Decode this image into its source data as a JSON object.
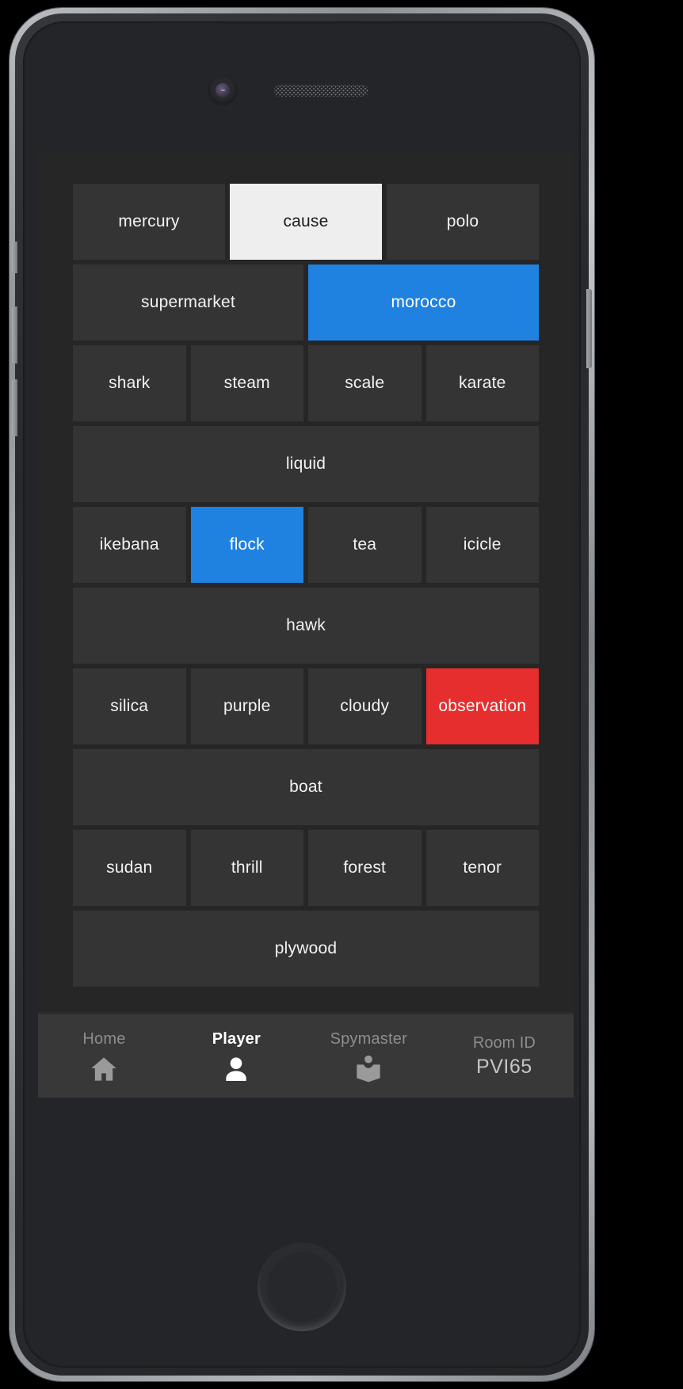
{
  "device": {
    "camera_icon": "front-camera",
    "speaker_icon": "earpiece-speaker",
    "home_button_icon": "home-button"
  },
  "game": {
    "board": {
      "rows": [
        [
          {
            "word": "mercury",
            "state": "unrevealed",
            "color": "#343434"
          },
          {
            "word": "cause",
            "state": "neutral",
            "color": "#eeeeee"
          },
          {
            "word": "polo",
            "state": "unrevealed",
            "color": "#343434"
          }
        ],
        [
          {
            "word": "supermarket",
            "state": "unrevealed",
            "color": "#343434"
          },
          {
            "word": "morocco",
            "state": "blue",
            "color": "#1f82e0"
          }
        ],
        [
          {
            "word": "shark",
            "state": "unrevealed",
            "color": "#343434"
          },
          {
            "word": "steam",
            "state": "unrevealed",
            "color": "#343434"
          },
          {
            "word": "scale",
            "state": "unrevealed",
            "color": "#343434"
          },
          {
            "word": "karate",
            "state": "unrevealed",
            "color": "#343434"
          }
        ],
        [
          {
            "word": "liquid",
            "state": "unrevealed",
            "color": "#343434"
          }
        ],
        [
          {
            "word": "ikebana",
            "state": "unrevealed",
            "color": "#343434"
          },
          {
            "word": "flock",
            "state": "blue",
            "color": "#1f82e0"
          },
          {
            "word": "tea",
            "state": "unrevealed",
            "color": "#343434"
          },
          {
            "word": "icicle",
            "state": "unrevealed",
            "color": "#343434"
          }
        ],
        [
          {
            "word": "hawk",
            "state": "unrevealed",
            "color": "#343434"
          }
        ],
        [
          {
            "word": "silica",
            "state": "unrevealed",
            "color": "#343434"
          },
          {
            "word": "purple",
            "state": "unrevealed",
            "color": "#343434"
          },
          {
            "word": "cloudy",
            "state": "unrevealed",
            "color": "#343434"
          },
          {
            "word": "observation",
            "state": "red",
            "color": "#e62e2e"
          }
        ],
        [
          {
            "word": "boat",
            "state": "unrevealed",
            "color": "#343434"
          }
        ],
        [
          {
            "word": "sudan",
            "state": "unrevealed",
            "color": "#343434"
          },
          {
            "word": "thrill",
            "state": "unrevealed",
            "color": "#343434"
          },
          {
            "word": "forest",
            "state": "unrevealed",
            "color": "#343434"
          },
          {
            "word": "tenor",
            "state": "unrevealed",
            "color": "#343434"
          }
        ],
        [
          {
            "word": "plywood",
            "state": "unrevealed",
            "color": "#343434"
          }
        ]
      ]
    },
    "navbar": {
      "items": [
        {
          "label": "Home",
          "icon": "home-icon",
          "active": false
        },
        {
          "label": "Player",
          "icon": "person-icon",
          "active": true
        },
        {
          "label": "Spymaster",
          "icon": "spymaster-icon",
          "active": false
        }
      ],
      "room": {
        "label": "Room ID",
        "code": "PVI65"
      }
    },
    "colors": {
      "blue_team": "#1f82e0",
      "red_team": "#e62e2e",
      "neutral": "#eeeeee",
      "unrevealed": "#343434",
      "background": "#262626",
      "navbar": "#383838"
    }
  }
}
